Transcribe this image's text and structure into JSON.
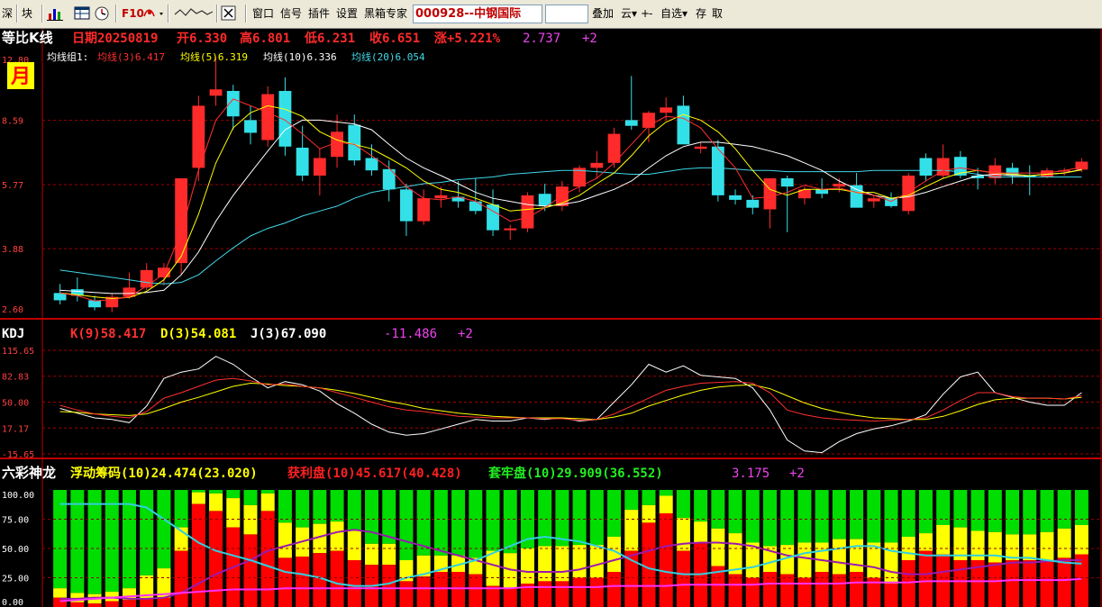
{
  "toolbar": {
    "items_left": [
      "深",
      "块"
    ],
    "f10_label": "F10",
    "menu": [
      "窗口",
      "信号",
      "插件",
      "设置",
      "黑箱专家"
    ],
    "stock_code": "000928--中钢国际",
    "right": [
      "叠加",
      "云▾",
      "自选▾",
      "存",
      "取"
    ],
    "plus_label": "+",
    "minus_label": "-"
  },
  "colors": {
    "up": "#ff2a2a",
    "down": "#33e0e8",
    "ma3": "#ff3030",
    "ma5": "#ffff00",
    "ma10": "#ffffff",
    "ma20": "#40d8e8",
    "k": "#ff3030",
    "d": "#ffff00",
    "j": "#ffffff",
    "float": "#ffff00",
    "profit": "#ff0000",
    "trapped": "#00dd00",
    "grid": "#a00000"
  },
  "chart_data": [
    {
      "type": "candlestick",
      "title": "等比K线",
      "info": {
        "date": "日期20250819",
        "open": "开6.330",
        "high": "高6.801",
        "low": "低6.231",
        "close": "收6.651",
        "change": "涨+5.221%",
        "extra": "2.737",
        "plus": "+2"
      },
      "period_label": "月",
      "ma_group_label": "均线组1:",
      "ma_labels": [
        "均线(3)6.417",
        "均线(5)6.319",
        "均线(10)6.336",
        "均线(20)6.054"
      ],
      "y_ticks": [
        "12.80",
        "8.59",
        "5.77",
        "3.88",
        "2.60"
      ],
      "y_scale": "log",
      "ylim": [
        2.6,
        12.8
      ],
      "candles": [
        {
          "o": 2.95,
          "h": 3.12,
          "l": 2.75,
          "c": 2.82
        },
        {
          "o": 3.02,
          "h": 3.25,
          "l": 2.8,
          "c": 2.9
        },
        {
          "o": 2.82,
          "h": 2.9,
          "l": 2.65,
          "c": 2.7
        },
        {
          "o": 2.7,
          "h": 2.95,
          "l": 2.62,
          "c": 2.88
        },
        {
          "o": 2.88,
          "h": 3.35,
          "l": 2.85,
          "c": 3.05
        },
        {
          "o": 3.05,
          "h": 3.55,
          "l": 3.0,
          "c": 3.4
        },
        {
          "o": 3.25,
          "h": 3.55,
          "l": 3.1,
          "c": 3.45
        },
        {
          "o": 3.55,
          "h": 4.6,
          "l": 3.3,
          "c": 6.0
        },
        {
          "o": 6.4,
          "h": 10.0,
          "l": 5.9,
          "c": 9.4
        },
        {
          "o": 10.0,
          "h": 12.7,
          "l": 9.4,
          "c": 10.4
        },
        {
          "o": 10.3,
          "h": 10.7,
          "l": 8.1,
          "c": 8.8
        },
        {
          "o": 8.6,
          "h": 9.4,
          "l": 7.4,
          "c": 7.95
        },
        {
          "o": 7.6,
          "h": 10.6,
          "l": 7.3,
          "c": 10.1
        },
        {
          "o": 10.3,
          "h": 11.2,
          "l": 6.9,
          "c": 7.3
        },
        {
          "o": 7.25,
          "h": 8.3,
          "l": 5.9,
          "c": 6.1
        },
        {
          "o": 6.1,
          "h": 7.2,
          "l": 5.4,
          "c": 6.8
        },
        {
          "o": 6.85,
          "h": 8.9,
          "l": 6.4,
          "c": 8.0
        },
        {
          "o": 8.35,
          "h": 8.9,
          "l": 6.5,
          "c": 6.7
        },
        {
          "o": 6.8,
          "h": 7.4,
          "l": 6.1,
          "c": 6.3
        },
        {
          "o": 6.35,
          "h": 6.7,
          "l": 5.2,
          "c": 5.6
        },
        {
          "o": 5.6,
          "h": 5.8,
          "l": 4.2,
          "c": 4.6
        },
        {
          "o": 4.6,
          "h": 5.6,
          "l": 4.5,
          "c": 5.3
        },
        {
          "o": 5.3,
          "h": 5.7,
          "l": 5.0,
          "c": 5.4
        },
        {
          "o": 5.35,
          "h": 5.9,
          "l": 5.0,
          "c": 5.2
        },
        {
          "o": 5.2,
          "h": 6.0,
          "l": 4.8,
          "c": 4.9
        },
        {
          "o": 5.1,
          "h": 5.6,
          "l": 4.2,
          "c": 4.35
        },
        {
          "o": 4.35,
          "h": 4.5,
          "l": 4.1,
          "c": 4.4
        },
        {
          "o": 4.4,
          "h": 5.5,
          "l": 4.3,
          "c": 5.4
        },
        {
          "o": 5.45,
          "h": 5.8,
          "l": 4.9,
          "c": 5.05
        },
        {
          "o": 5.05,
          "h": 5.9,
          "l": 4.9,
          "c": 5.7
        },
        {
          "o": 5.7,
          "h": 6.5,
          "l": 5.5,
          "c": 6.4
        },
        {
          "o": 6.4,
          "h": 7.1,
          "l": 6.0,
          "c": 6.6
        },
        {
          "o": 6.6,
          "h": 8.2,
          "l": 6.4,
          "c": 7.9
        },
        {
          "o": 8.6,
          "h": 11.3,
          "l": 8.1,
          "c": 8.3
        },
        {
          "o": 8.2,
          "h": 9.1,
          "l": 7.5,
          "c": 9.0
        },
        {
          "o": 9.0,
          "h": 9.9,
          "l": 8.6,
          "c": 9.3
        },
        {
          "o": 9.4,
          "h": 10.0,
          "l": 7.6,
          "c": 7.4
        },
        {
          "o": 7.2,
          "h": 7.5,
          "l": 7.0,
          "c": 7.3
        },
        {
          "o": 7.3,
          "h": 7.6,
          "l": 5.2,
          "c": 5.4
        },
        {
          "o": 5.4,
          "h": 5.6,
          "l": 5.1,
          "c": 5.25
        },
        {
          "o": 5.25,
          "h": 5.4,
          "l": 4.8,
          "c": 5.0
        },
        {
          "o": 4.95,
          "h": 6.0,
          "l": 4.4,
          "c": 6.0
        },
        {
          "o": 6.0,
          "h": 6.1,
          "l": 4.3,
          "c": 5.7
        },
        {
          "o": 5.3,
          "h": 5.7,
          "l": 5.1,
          "c": 5.6
        },
        {
          "o": 5.6,
          "h": 6.0,
          "l": 5.3,
          "c": 5.45
        },
        {
          "o": 5.7,
          "h": 6.0,
          "l": 5.5,
          "c": 5.8
        },
        {
          "o": 5.75,
          "h": 6.2,
          "l": 5.4,
          "c": 5.0
        },
        {
          "o": 5.2,
          "h": 5.4,
          "l": 5.0,
          "c": 5.3
        },
        {
          "o": 5.3,
          "h": 5.5,
          "l": 5.0,
          "c": 5.05
        },
        {
          "o": 4.9,
          "h": 6.2,
          "l": 4.8,
          "c": 6.1
        },
        {
          "o": 6.8,
          "h": 7.0,
          "l": 5.9,
          "c": 6.1
        },
        {
          "o": 6.1,
          "h": 7.4,
          "l": 6.0,
          "c": 6.8
        },
        {
          "o": 6.85,
          "h": 7.1,
          "l": 6.0,
          "c": 6.1
        },
        {
          "o": 6.1,
          "h": 6.4,
          "l": 5.6,
          "c": 6.0
        },
        {
          "o": 6.0,
          "h": 6.8,
          "l": 5.8,
          "c": 6.5
        },
        {
          "o": 6.4,
          "h": 6.6,
          "l": 5.8,
          "c": 6.1
        },
        {
          "o": 6.1,
          "h": 6.5,
          "l": 5.4,
          "c": 6.05
        },
        {
          "o": 6.05,
          "h": 6.4,
          "l": 6.0,
          "c": 6.3
        },
        {
          "o": 6.25,
          "h": 6.4,
          "l": 6.1,
          "c": 6.3
        },
        {
          "o": 6.33,
          "h": 6.8,
          "l": 6.23,
          "c": 6.65
        }
      ],
      "ma3": [
        2.95,
        2.9,
        2.81,
        2.83,
        2.88,
        3.08,
        3.32,
        4.3,
        6.3,
        8.6,
        9.8,
        9.4,
        9.0,
        8.6,
        7.9,
        7.2,
        7.5,
        7.4,
        6.9,
        6.4,
        5.7,
        5.3,
        5.25,
        5.35,
        5.2,
        4.9,
        4.6,
        4.7,
        5.0,
        5.4,
        5.7,
        6.0,
        6.6,
        7.4,
        8.3,
        8.8,
        8.7,
        8.2,
        7.2,
        6.4,
        5.3,
        5.35,
        5.5,
        5.75,
        5.6,
        5.65,
        5.5,
        5.4,
        5.2,
        5.5,
        5.9,
        6.3,
        6.4,
        6.3,
        6.2,
        6.2,
        6.2,
        6.2,
        6.3,
        6.42
      ],
      "ma5": [
        2.95,
        2.92,
        2.88,
        2.85,
        2.87,
        2.98,
        3.2,
        3.7,
        4.8,
        6.6,
        8.2,
        9.0,
        9.4,
        9.2,
        8.8,
        8.0,
        7.6,
        7.4,
        7.2,
        6.8,
        6.4,
        5.9,
        5.6,
        5.5,
        5.3,
        5.1,
        4.9,
        4.95,
        5.0,
        5.15,
        5.4,
        5.8,
        6.2,
        6.9,
        7.8,
        8.5,
        8.9,
        8.6,
        8.0,
        7.2,
        6.3,
        5.6,
        5.4,
        5.6,
        5.6,
        5.6,
        5.5,
        5.5,
        5.3,
        5.4,
        5.7,
        6.0,
        6.2,
        6.3,
        6.2,
        6.15,
        6.1,
        6.15,
        6.2,
        6.32
      ],
      "ma10": [
        3.0,
        2.98,
        2.96,
        2.94,
        2.94,
        2.96,
        3.0,
        3.3,
        3.8,
        4.6,
        5.4,
        6.2,
        7.1,
        8.1,
        8.6,
        8.6,
        8.5,
        8.4,
        8.1,
        7.4,
        6.8,
        6.4,
        6.1,
        5.8,
        5.5,
        5.3,
        5.2,
        5.1,
        5.05,
        5.1,
        5.2,
        5.4,
        5.6,
        5.9,
        6.4,
        6.9,
        7.3,
        7.5,
        7.5,
        7.4,
        7.3,
        7.1,
        6.9,
        6.6,
        6.3,
        5.9,
        5.6,
        5.4,
        5.3,
        5.35,
        5.5,
        5.7,
        5.9,
        6.1,
        6.15,
        6.1,
        6.1,
        6.15,
        6.2,
        6.34
      ],
      "ma20": [
        3.4,
        3.35,
        3.3,
        3.25,
        3.2,
        3.15,
        3.12,
        3.15,
        3.3,
        3.6,
        3.9,
        4.2,
        4.4,
        4.55,
        4.75,
        4.9,
        5.05,
        5.3,
        5.5,
        5.6,
        5.7,
        5.8,
        5.85,
        5.95,
        6.0,
        6.05,
        6.15,
        6.2,
        6.25,
        6.3,
        6.3,
        6.25,
        6.2,
        6.15,
        6.15,
        6.25,
        6.35,
        6.4,
        6.4,
        6.35,
        6.3,
        6.3,
        6.25,
        6.25,
        6.25,
        6.25,
        6.25,
        6.3,
        6.3,
        6.3,
        6.3,
        6.3,
        6.25,
        6.15,
        6.05,
        6.05,
        6.05,
        6.05,
        6.05,
        6.05
      ]
    },
    {
      "type": "line",
      "title": "KDJ",
      "labels": [
        "K(9)58.417",
        "D(3)54.081",
        "J(3)67.090"
      ],
      "extra": "-11.486",
      "plus": "+2",
      "y_ticks": [
        "115.65",
        "82.83",
        "50.00",
        "17.17",
        "-15.65"
      ],
      "ylim": [
        -15.65,
        115.65
      ],
      "k": [
        46,
        40,
        35,
        32,
        30,
        38,
        55,
        62,
        70,
        78,
        80,
        77,
        72,
        73,
        70,
        68,
        62,
        56,
        50,
        44,
        40,
        38,
        35,
        32,
        31,
        30,
        30,
        30,
        29,
        29,
        27,
        28,
        35,
        45,
        55,
        65,
        70,
        74,
        75,
        76,
        74,
        62,
        40,
        34,
        30,
        28,
        27,
        26,
        27,
        28,
        30,
        40,
        52,
        62,
        62,
        57,
        55,
        55,
        54,
        58
      ],
      "d": [
        38,
        37,
        35,
        34,
        33,
        35,
        42,
        50,
        56,
        63,
        70,
        74,
        73,
        71,
        70,
        68,
        65,
        61,
        56,
        51,
        47,
        42,
        39,
        36,
        34,
        32,
        31,
        30,
        30,
        30,
        29,
        28,
        31,
        36,
        45,
        52,
        59,
        65,
        69,
        71,
        72,
        67,
        58,
        49,
        42,
        37,
        33,
        30,
        29,
        28,
        28,
        32,
        39,
        47,
        53,
        55,
        55,
        55,
        54,
        56
      ],
      "j": [
        42,
        36,
        30,
        28,
        24,
        45,
        80,
        88,
        92,
        108,
        98,
        82,
        68,
        76,
        72,
        64,
        48,
        36,
        22,
        12,
        8,
        10,
        16,
        22,
        28,
        26,
        26,
        30,
        28,
        30,
        26,
        28,
        50,
        72,
        98,
        88,
        96,
        84,
        82,
        80,
        68,
        40,
        2,
        -12,
        -14,
        0,
        10,
        16,
        20,
        26,
        34,
        60,
        82,
        88,
        62,
        56,
        50,
        46,
        46,
        62
      ]
    },
    {
      "type": "stacked_bar",
      "title": "六彩神龙",
      "labels": [
        "浮动筹码(10)24.474(23.020)",
        "获利盘(10)45.617(40.428)",
        "套牢盘(10)29.909(36.552)"
      ],
      "extra": "3.175",
      "plus": "+2",
      "y_ticks": [
        "100.00",
        "75.00",
        "50.00",
        "25.00",
        "0.00"
      ],
      "ylim": [
        0,
        100
      ],
      "red": [
        8,
        4,
        3,
        5,
        6,
        7,
        8,
        48,
        88,
        82,
        68,
        62,
        82,
        42,
        43,
        46,
        48,
        40,
        36,
        36,
        22,
        26,
        30,
        30,
        28,
        18,
        16,
        20,
        22,
        22,
        25,
        25,
        30,
        48,
        72,
        80,
        48,
        55,
        35,
        28,
        25,
        30,
        28,
        25,
        30,
        28,
        30,
        25,
        20,
        40,
        48,
        45,
        40,
        40,
        38,
        40,
        40,
        40,
        42,
        45
      ],
      "yellow": [
        8,
        8,
        8,
        8,
        10,
        20,
        25,
        20,
        10,
        15,
        25,
        25,
        15,
        30,
        25,
        25,
        25,
        25,
        18,
        18,
        18,
        18,
        14,
        14,
        14,
        30,
        30,
        30,
        30,
        30,
        28,
        28,
        30,
        35,
        15,
        15,
        28,
        18,
        32,
        35,
        30,
        22,
        25,
        30,
        25,
        30,
        28,
        30,
        35,
        20,
        15,
        25,
        28,
        25,
        26,
        22,
        22,
        24,
        25,
        25
      ],
      "purple": [
        7,
        7,
        8,
        8,
        7,
        7,
        8,
        12,
        20,
        28,
        34,
        40,
        48,
        52,
        56,
        60,
        64,
        66,
        64,
        60,
        56,
        52,
        48,
        44,
        40,
        36,
        32,
        30,
        30,
        30,
        32,
        36,
        40,
        44,
        48,
        52,
        54,
        55,
        55,
        54,
        52,
        48,
        44,
        42,
        40,
        38,
        36,
        34,
        30,
        28,
        28,
        30,
        32,
        34,
        36,
        38,
        38,
        39,
        40,
        40
      ],
      "cyan": [
        88,
        88,
        88,
        88,
        88,
        85,
        75,
        65,
        55,
        48,
        44,
        40,
        35,
        30,
        28,
        25,
        20,
        18,
        18,
        20,
        25,
        28,
        32,
        36,
        40,
        46,
        52,
        58,
        60,
        58,
        56,
        52,
        48,
        40,
        33,
        30,
        28,
        28,
        30,
        32,
        34,
        38,
        42,
        46,
        48,
        50,
        52,
        52,
        48,
        46,
        44,
        44,
        44,
        44,
        44,
        42,
        42,
        40,
        38,
        37
      ],
      "magenta": [
        5,
        6,
        7,
        8,
        9,
        10,
        11,
        12,
        13,
        14,
        15,
        15,
        15,
        16,
        16,
        16,
        16,
        16,
        16,
        16,
        16,
        16,
        16,
        16,
        16,
        16,
        16,
        17,
        17,
        17,
        17,
        17,
        18,
        18,
        18,
        18,
        19,
        19,
        19,
        19,
        19,
        20,
        20,
        20,
        20,
        20,
        21,
        21,
        21,
        21,
        22,
        22,
        22,
        22,
        22,
        23,
        23,
        23,
        23,
        24
      ]
    }
  ]
}
